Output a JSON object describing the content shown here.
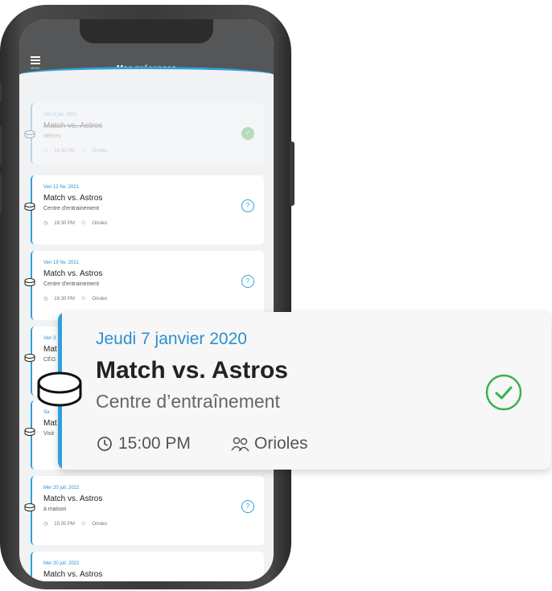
{
  "app": {
    "title": "Mes présences",
    "menu_label": "MENU"
  },
  "list": [
    {
      "date": "Ven 3 jan. 2021",
      "title": "Match vs. Astros",
      "location": "dehors",
      "time": "14:30 PM",
      "team": "Orioles",
      "status": "confirmed",
      "faded": true
    },
    {
      "date": "Ven 12 Nv. 2021",
      "title": "Match vs. Astros",
      "location": "Centre d'entrainement",
      "time": "18:30 PM",
      "team": "Orioles",
      "status": "pending",
      "faded": false
    },
    {
      "date": "Ven 19 Nv. 2021",
      "title": "Match vs. Astros",
      "location": "Centre d'entrainement",
      "time": "18:30 PM",
      "team": "Orioles",
      "status": "pending",
      "faded": false
    },
    {
      "date": "Ven 3",
      "title": "Mat",
      "location": "CÉG",
      "time": "",
      "team": "",
      "status": "",
      "faded": false
    },
    {
      "date": "Sa",
      "title": "Mat",
      "location": "Visit",
      "time": "",
      "team": "",
      "status": "",
      "faded": false
    },
    {
      "date": "Mer 20 juil. 2022",
      "title": "Match vs. Astros",
      "location": "à maison",
      "time": "15:05 PM",
      "team": "Orioles",
      "status": "pending",
      "faded": false
    },
    {
      "date": "Mer 20 juil. 2022",
      "title": "Match vs. Astros",
      "location": "",
      "time": "",
      "team": "",
      "status": "",
      "faded": false
    }
  ],
  "detail": {
    "date": "Jeudi 7 janvier 2020",
    "title": "Match vs. Astros",
    "location": "Centre d’entraînement",
    "time": "15:00 PM",
    "team": "Orioles",
    "status": "confirmed"
  },
  "colors": {
    "accent": "#2fa0dc",
    "confirmed": "#38b24a",
    "appbar": "#555657"
  },
  "icons": {
    "menu": "hamburger-icon",
    "clock": "clock-icon",
    "team": "team-icon",
    "confirmed": "check-circle-icon",
    "pending": "question-circle-icon",
    "puck": "hockey-puck-icon"
  }
}
